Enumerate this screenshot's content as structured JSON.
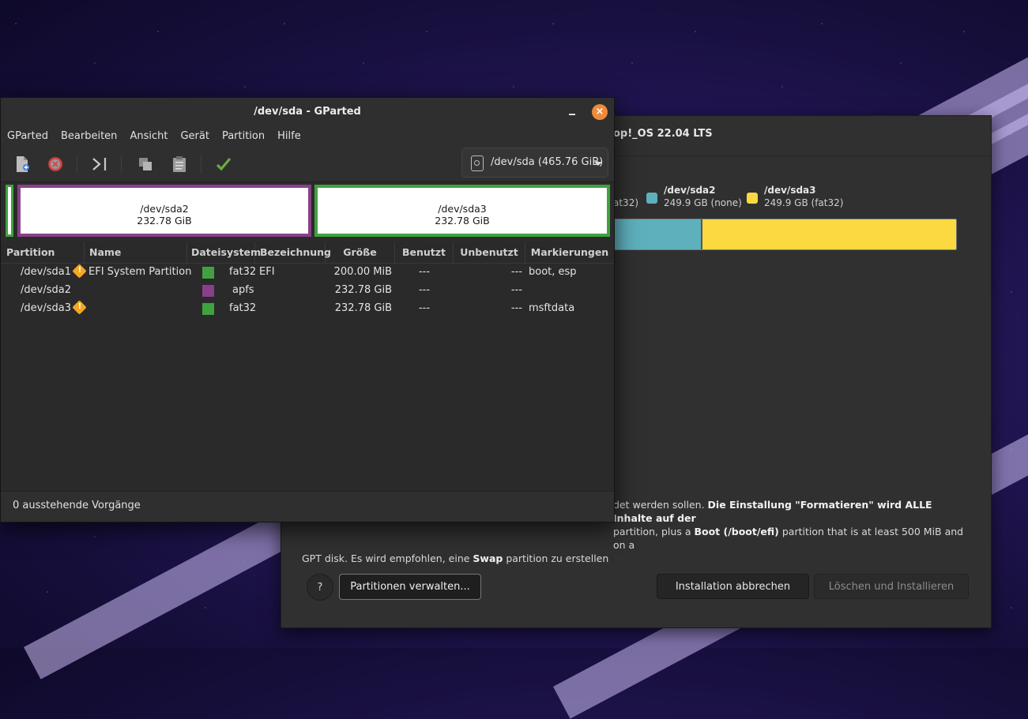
{
  "installer": {
    "title_partial": "op!_OS 22.04 LTS",
    "legend": [
      {
        "name": "",
        "size": "at32)",
        "color": "#5fb0bd"
      },
      {
        "name": "/dev/sda2",
        "size": "249.9 GB (none)",
        "color": "#5fb0bd"
      },
      {
        "name": "/dev/sda3",
        "size": "249.9 GB (fat32)",
        "color": "#fcd940"
      }
    ],
    "bar_fractions": {
      "sda2": 0.5,
      "sda3": 0.5
    },
    "info_line1_a": "det werden sollen. ",
    "info_line1_b": "Die Einstallung \"Formatieren\" wird ALLE Inhalte auf der",
    "info_line2_a": "partition, plus a ",
    "info_line2_b": "Boot (/boot/efi)",
    "info_line2_c": " partition that is at least 500 MiB and on a",
    "info_line3_a": "GPT disk. Es wird empfohlen, eine ",
    "info_line3_b": "Swap",
    "info_line3_c": " partition zu erstellen",
    "help_label": "?",
    "manage_label": "Partitionen verwalten...",
    "cancel_label": "Installation abbrechen",
    "erase_label": "Löschen und Installieren"
  },
  "gparted": {
    "title": "/dev/sda - GParted",
    "menu": [
      "GParted",
      "Bearbeiten",
      "Ansicht",
      "Gerät",
      "Partition",
      "Hilfe"
    ],
    "device": "/dev/sda (465.76 GiB)",
    "map": [
      {
        "name": "/dev/sda2",
        "size": "232.78 GiB"
      },
      {
        "name": "/dev/sda3",
        "size": "232.78 GiB"
      }
    ],
    "columns": [
      "Partition",
      "Name",
      "Dateisystem",
      "Bezeichnung",
      "Größe",
      "Benutzt",
      "Unbenutzt",
      "Markierungen"
    ],
    "rows": [
      {
        "partition": "/dev/sda1",
        "warn": true,
        "name": "EFI System Partition",
        "fs": "fat32",
        "fs_color": "#3fa23f",
        "label": "EFI",
        "size": "200.00 MiB",
        "used": "---",
        "unused": "---",
        "flags": "boot, esp"
      },
      {
        "partition": "/dev/sda2",
        "warn": false,
        "name": "",
        "fs": "apfs",
        "fs_color": "#8a3f8a",
        "label": "",
        "size": "232.78 GiB",
        "used": "---",
        "unused": "---",
        "flags": ""
      },
      {
        "partition": "/dev/sda3",
        "warn": true,
        "name": "",
        "fs": "fat32",
        "fs_color": "#3fa23f",
        "label": "",
        "size": "232.78 GiB",
        "used": "---",
        "unused": "---",
        "flags": "msftdata"
      }
    ],
    "status": "0 ausstehende Vorgänge"
  }
}
